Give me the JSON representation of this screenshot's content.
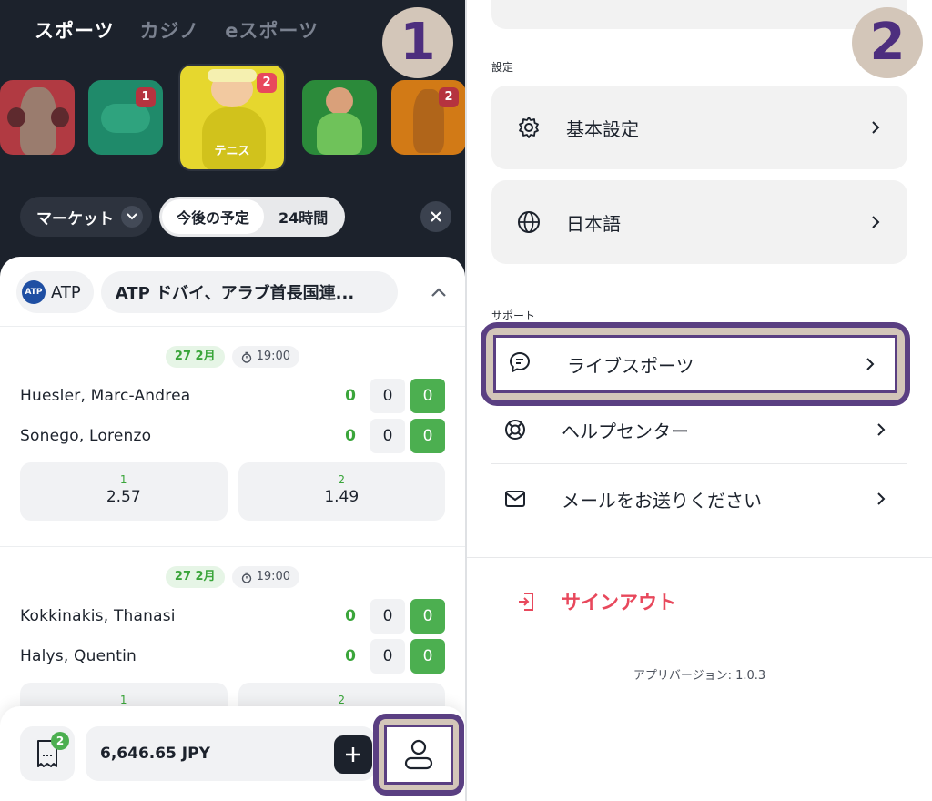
{
  "left": {
    "top_tabs": [
      "スポーツ",
      "カジノ",
      "eスポーツ"
    ],
    "step_badge": "1",
    "sports": [
      {
        "icon": "boxing",
        "label": "",
        "count": ""
      },
      {
        "icon": "esports-controller",
        "label": "",
        "count": "1"
      },
      {
        "icon": "tennis",
        "label": "テニス",
        "count": "2"
      },
      {
        "icon": "soccer",
        "label": "",
        "count": ""
      },
      {
        "icon": "basketball",
        "label": "",
        "count": "2"
      }
    ],
    "filter": {
      "market_label": "マーケット",
      "segments": [
        "今後の予定",
        "24時間"
      ]
    },
    "league": {
      "chip_label": "ATP",
      "logo_text": "ATP",
      "title": "ATP ドバイ、アラブ首長国連..."
    },
    "matches": [
      {
        "date": "27 2月",
        "time": "19:00",
        "players": [
          {
            "name": "Huesler, Marc-Andrea",
            "s1": "0",
            "s2": "0",
            "s3": "0"
          },
          {
            "name": "Sonego, Lorenzo",
            "s1": "0",
            "s2": "0",
            "s3": "0"
          }
        ],
        "odds": [
          {
            "label": "1",
            "value": "2.57"
          },
          {
            "label": "2",
            "value": "1.49"
          }
        ]
      },
      {
        "date": "27 2月",
        "time": "19:00",
        "players": [
          {
            "name": "Kokkinakis, Thanasi",
            "s1": "0",
            "s2": "0",
            "s3": "0"
          },
          {
            "name": "Halys, Quentin",
            "s1": "0",
            "s2": "0",
            "s3": "0"
          }
        ],
        "odds": [
          {
            "label": "1",
            "value": ""
          },
          {
            "label": "2",
            "value": ""
          }
        ]
      }
    ],
    "bottom": {
      "slip_count": "2",
      "balance": "6,646.65 JPY"
    }
  },
  "right": {
    "step_badge": "2",
    "settings_title": "設定",
    "settings": [
      {
        "icon": "gear-icon",
        "label": "基本設定"
      },
      {
        "icon": "globe-icon",
        "label": "日本語"
      }
    ],
    "support_title": "サポート",
    "support": [
      {
        "icon": "chat-icon",
        "label": "ライブスポーツ"
      },
      {
        "icon": "lifebuoy-icon",
        "label": "ヘルプセンター"
      },
      {
        "icon": "mail-icon",
        "label": "メールをお送りください"
      }
    ],
    "signout_label": "サインアウト",
    "version": "アプリバージョン: 1.0.3"
  },
  "colors": {
    "dark_bg": "#1c222c",
    "accent_green": "#4caf50",
    "signout_red": "#e8485c",
    "highlight_purple": "#5a3f82",
    "highlight_beige": "#d3c6b9"
  }
}
